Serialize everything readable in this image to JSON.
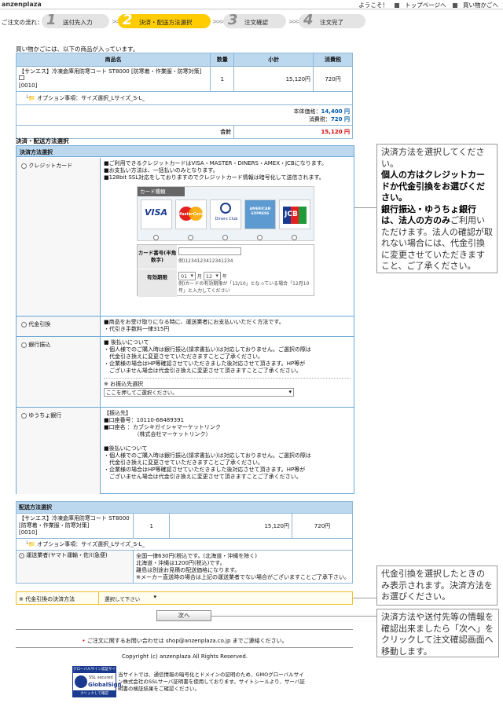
{
  "header": {
    "brand": "anzenplaza",
    "welcome": "ようこそ！",
    "top_link": "トップページへ",
    "cart_link": "買い物かごへ"
  },
  "steps": {
    "lead": "ご注文の流れ：",
    "items": [
      {
        "num": "1",
        "label": "送付先入力"
      },
      {
        "num": "2",
        "label": "決済・配送方法選択"
      },
      {
        "num": "3",
        "label": "注文確認"
      },
      {
        "num": "4",
        "label": "注文完了"
      }
    ]
  },
  "notice": "買い物かごには、以下の商品が入っています。",
  "cart": {
    "headers": [
      "商品名",
      "数量",
      "小計",
      "消費税"
    ],
    "item_name": "【サンエス】冷凍倉庫用防寒コート ST8000 [防寒着・作業服・防寒対策]",
    "item_code": "[0010]",
    "qty": "1",
    "subtotal": "15,120円",
    "tax": "720円",
    "option": "オプション事項：サイズ選択_Lサイズ_S-L_",
    "price_label": "本体価格：",
    "price_value": "14,400 円",
    "tax_label": "消費税：",
    "tax_value": "720 円",
    "total_label": "合計",
    "total_value": "15,120 円"
  },
  "payment": {
    "section_label": "決済・配送方法選択",
    "title": "決済方法選択",
    "credit": {
      "label": "クレジットカード",
      "lines": [
        "■ご利用できるクレジットカードはVISA・MASTER・DINERS・AMEX・JCBになります。",
        "■お支払い方法は、一括払いのみとなります。",
        "■128bit SSL対応をしておりますのでクレジットカード情報は暗号化して送信されます。"
      ],
      "card_type": "カード種類",
      "card_names": [
        "VISA",
        "MasterCard",
        "Diners Club",
        "AMERICAN EXPRESS",
        "JCB"
      ],
      "card_number_label": "カード番号(半角数字)",
      "card_number_example": "例)1234123412341234",
      "expiry_label": "有効期限",
      "expiry_month": "01",
      "expiry_month_unit": "月",
      "expiry_year": "12",
      "expiry_year_unit": "年",
      "expiry_note": "例)カードの有効期限が「12/10」となっている場合「12月10年」と入力してください"
    },
    "cod": {
      "label": "代金引換",
      "lines": [
        "■商品をお受け取りになる時に、運送業者にお支払いいただく方法です。",
        "・代引き手数料一律315円"
      ]
    },
    "bank": {
      "label": "銀行振込",
      "lines": [
        "■ 後払いについて",
        "・個人様でのご購入時は銀行振込(請求書払い)は対応しておりません。ご選択の際は",
        "　代金引き換えに変更させていただきますことご了承ください。",
        "・企業様の場合はHP等確認させていただきました後対応させて頂きます。HP等が",
        "　ございません場合は代金引き換えに変更させて頂きますことご了承ください。"
      ],
      "select_caption": "※ お振込先選択",
      "select_value": "ここを押してご選択ください。"
    },
    "postal": {
      "label": "ゆうちょ銀行",
      "lines": [
        "【振込先】",
        "■口座番号：10110-68489391",
        "■口座名 ：カブシキガイシャマーケットリンク",
        "　　　　　　（株式会社マーケットリンク）",
        "",
        "■後払いについて",
        "・個人様でのご購入時は銀行振込(請求書払い)は対応しておりません。ご選択の際は",
        "　代金引き換えに変更させていただきますことご了承ください。",
        "・企業様の場合はHP等確認させていただきました後対応させて頂きます。HP等が",
        "　ございません場合は代金引き換えに変更させて頂きますことご了承ください。"
      ]
    }
  },
  "shipping": {
    "title": "配送方法選択",
    "item_name": "【サンエス】冷凍倉庫用防寒コート ST8000 [防寒着・作業服・防寒対策]",
    "item_code": "[0010]",
    "qty": "1",
    "subtotal": "15,120円",
    "tax": "720円",
    "option": "オプション事項：サイズ選択_Lサイズ_S-L_",
    "carrier": "運送業者(ヤマト運輸・佐川急便)",
    "lines": [
      "全国一律630円(税込です。(北海道・沖縄を除く)",
      "北海道・沖縄は1200円(税込)です。",
      "離島は別途お見積の配送価格になります。",
      "※メーカー直送時の場合は上記の運送業者でない場合がございますことご了承下さい。"
    ]
  },
  "cod_method": {
    "label": "※ 代金引換の決済方法",
    "value": "選択して下さい"
  },
  "next_button": "次へ",
  "footer": {
    "contact": "ご注文に関するお問い合わせは shop@anzenplaza.co.jp までご連絡ください。",
    "copyright": "Copyright (c) anzenplaza All Rights Reserved.",
    "seal_top": "グローバルサイン認証サイト",
    "seal_mid": "SSL secured",
    "seal_brand": "GlobalSign.",
    "seal_bottom": "クリックして確認",
    "ssl_text": "当サイトでは、通信情報の暗号化とドメインの証明のため、GMOグローバルサイン株式会社のSSLサーバ証明書を使用しております。サイトシールより、サーバ証明書の検証結果をご確認ください。"
  },
  "callouts": {
    "one_a": "決済方法を選択してください。",
    "one_b": "個人の方はクレジットカードか代金引換をお選びください。",
    "one_c": "銀行振込・ゆうちょ銀行は、法人の方のみ",
    "one_d": "ご利用いただけます。法人の確認が取れない場合には、代金引換に変更させていただきますこと、ご了承ください。",
    "two": "代金引換を選択したときのみ表示されます。決済方法をお選びください。",
    "three": "決済方法や送付先等の情報を確認出来ましたら「次へ」をクリックして注文確認画面へ移動します。"
  }
}
